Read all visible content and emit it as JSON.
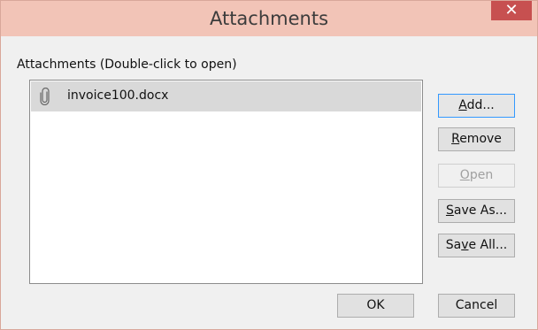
{
  "window": {
    "title": "Attachments",
    "close_glyph": "✕"
  },
  "list": {
    "label": "Attachments (Double-click to open)",
    "items": [
      {
        "name": "invoice100.docx",
        "icon": "paperclip-icon"
      }
    ]
  },
  "buttons": {
    "add": "Add...",
    "remove": "Remove",
    "open": "Open",
    "save_as": "Save As...",
    "save_all": "Save All...",
    "ok": "OK",
    "cancel": "Cancel"
  },
  "colors": {
    "titlebar": "#f2c4b7",
    "close": "#c75050",
    "selection": "#d9d9d9"
  }
}
